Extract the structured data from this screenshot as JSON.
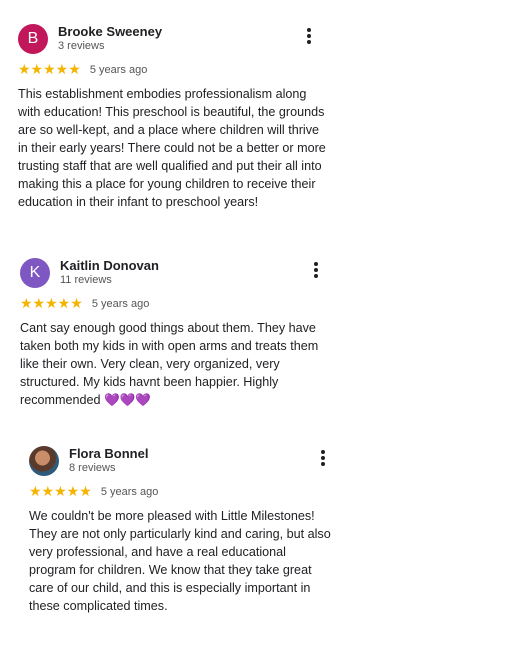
{
  "reviews": [
    {
      "avatar_letter": "B",
      "name": "Brooke Sweeney",
      "count": "3 reviews",
      "stars": "★★★★★",
      "date": "5 years ago",
      "text": "This establishment embodies professionalism along with education! This preschool is beautiful, the grounds are so well-kept, and a place where children will thrive in their early years! There could not be a better or more trusting staff that are well qualified and put their all into making this a place for young children to receive their education in their infant to preschool years!"
    },
    {
      "avatar_letter": "K",
      "name": "Kaitlin Donovan",
      "count": "11 reviews",
      "stars": "★★★★★",
      "date": "5 years ago",
      "text": "Cant say enough good things about them. They have taken both my kids in with open arms and treats them like their own. Very clean, very organized, very structured. My kids havnt been happier. Highly recommended 💜💜💜"
    },
    {
      "avatar_letter": "",
      "name": "Flora Bonnel",
      "count": "8 reviews",
      "stars": "★★★★★",
      "date": "5 years ago",
      "text": "We couldn't be more pleased with Little Milestones! They are not only particularly kind and caring, but also very professional, and have a real educational program for children. We know that they take great care of our child, and this is especially important in these complicated times."
    }
  ],
  "colors": {
    "star": "#f4b400",
    "avatar_b": "#c2185b",
    "avatar_k": "#7e57c2"
  },
  "icons": {
    "menu": "more-vert-icon",
    "star": "star-icon"
  }
}
